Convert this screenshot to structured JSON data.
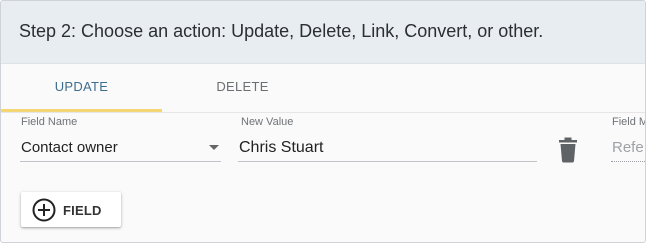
{
  "header": {
    "title": "Step 2: Choose an action: Update, Delete, Link, Convert, or other."
  },
  "tabs": [
    {
      "label": "UPDATE",
      "active": true
    },
    {
      "label": "DELETE",
      "active": false
    }
  ],
  "row": {
    "field_name_label": "Field Name",
    "field_name_value": "Contact owner",
    "new_value_label": "New Value",
    "new_value_value": "Chris Stuart",
    "third_label": "Field M",
    "third_placeholder": "Refe"
  },
  "add_button": {
    "label": "FIELD",
    "icon": "plus-circle-icon"
  },
  "colors": {
    "header_bg": "#e8edf1",
    "active_tab_text": "#3e6e8e",
    "active_tab_underline": "#f4d774",
    "inactive_tab_text": "#6b6f73"
  }
}
